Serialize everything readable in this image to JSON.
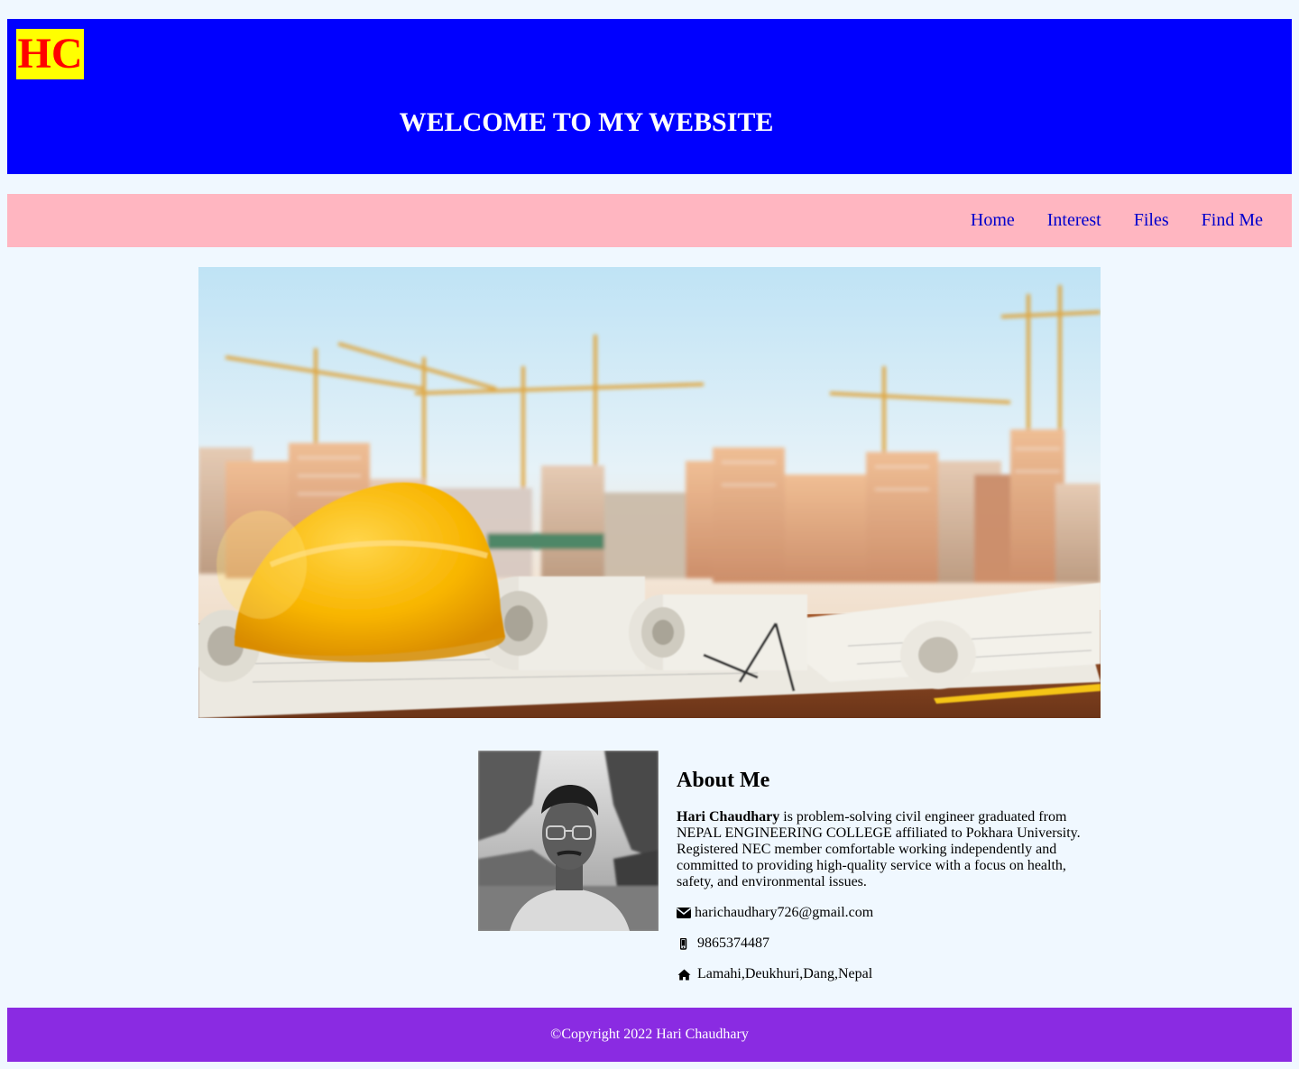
{
  "header": {
    "logo_text": "HC",
    "welcome": "WELCOME TO MY WEBSITE"
  },
  "nav": {
    "items": [
      {
        "label": "Home"
      },
      {
        "label": "Interest"
      },
      {
        "label": "Files"
      },
      {
        "label": "Find Me"
      }
    ]
  },
  "hero": {
    "image": "construction-site-hardhat-blueprints-image"
  },
  "about": {
    "portrait": "profile-photo-image",
    "title": "About Me",
    "name": "Hari Chaudhary",
    "bio": " is problem-solving civil engineer graduated from NEPAL ENGINEERING COLLEGE affiliated to Pokhara University. Registered NEC member comfortable working independently and committed to providing high-quality service with a focus on health, safety, and environmental issues.",
    "email": "harichaudhary726@gmail.com",
    "phone": "9865374487",
    "address": "Lamahi,Deukhuri,Dang,Nepal",
    "icons": {
      "email": "envelope-icon",
      "phone": "mobile-phone-icon",
      "address": "home-icon"
    }
  },
  "footer": {
    "text": "©Copyright 2022 Hari Chaudhary"
  },
  "colors": {
    "page_bg": "#f0f8ff",
    "header_bg": "#0000ff",
    "logo_bg": "#ffff00",
    "logo_text": "#ff0000",
    "nav_bg": "#ffb6c1",
    "nav_link": "#0000cd",
    "footer_bg": "#8a2be2"
  }
}
